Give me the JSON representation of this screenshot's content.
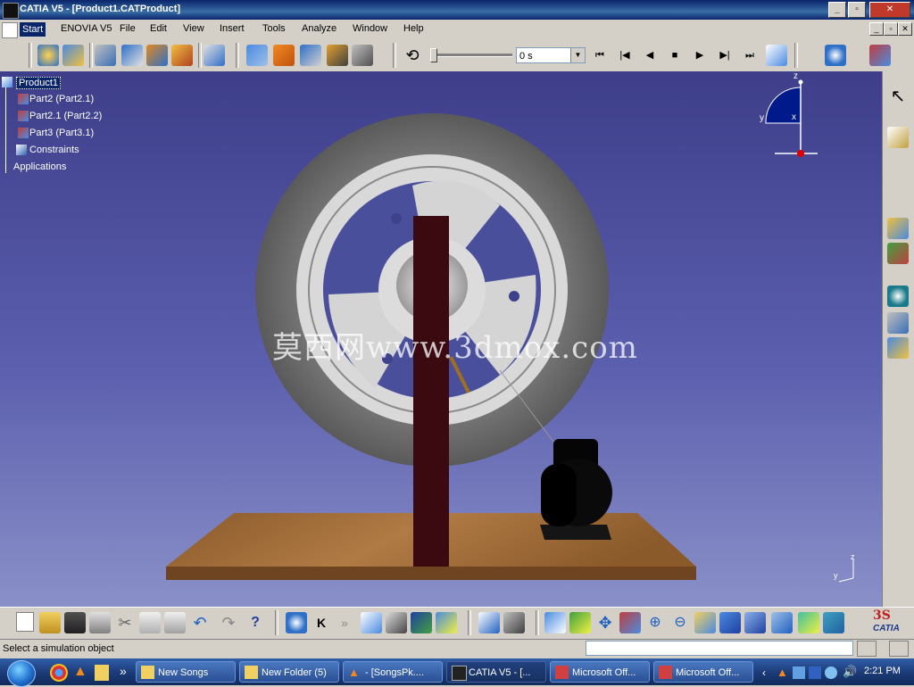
{
  "window": {
    "title": "CATIA V5 - [Product1.CATProduct]"
  },
  "menu": {
    "items": [
      "Start",
      "ENOVIA V5",
      "File",
      "Edit",
      "View",
      "Insert",
      "Tools",
      "Analyze",
      "Window",
      "Help"
    ]
  },
  "simulation": {
    "time_value": "0 s"
  },
  "tree": {
    "root": "Product1",
    "items": [
      "Part2 (Part2.1)",
      "Part2.1 (Part2.2)",
      "Part3 (Part3.1)",
      "Constraints",
      "Applications"
    ]
  },
  "watermark": "莫西网www.3dmox.com",
  "compass": {
    "z": "z",
    "y": "y",
    "x": "x"
  },
  "axis_triad": {
    "z": "z",
    "y": "y",
    "x": "x"
  },
  "status": {
    "text": "Select a simulation object"
  },
  "branding": {
    "logo": "CATIA"
  },
  "taskbar": {
    "buttons": [
      "New Songs",
      "New Folder (5)",
      "- [SongsPk....",
      "CATIA V5 - [...",
      "Microsoft Off...",
      "Microsoft Off..."
    ],
    "clock": "2:21 PM",
    "overflow": "»"
  },
  "colors": {
    "viewport_top": "#3e3e8a",
    "viewport_bottom": "#8a90c8",
    "titlebar": "#0a246a",
    "tree_selection": "#0a246a"
  }
}
